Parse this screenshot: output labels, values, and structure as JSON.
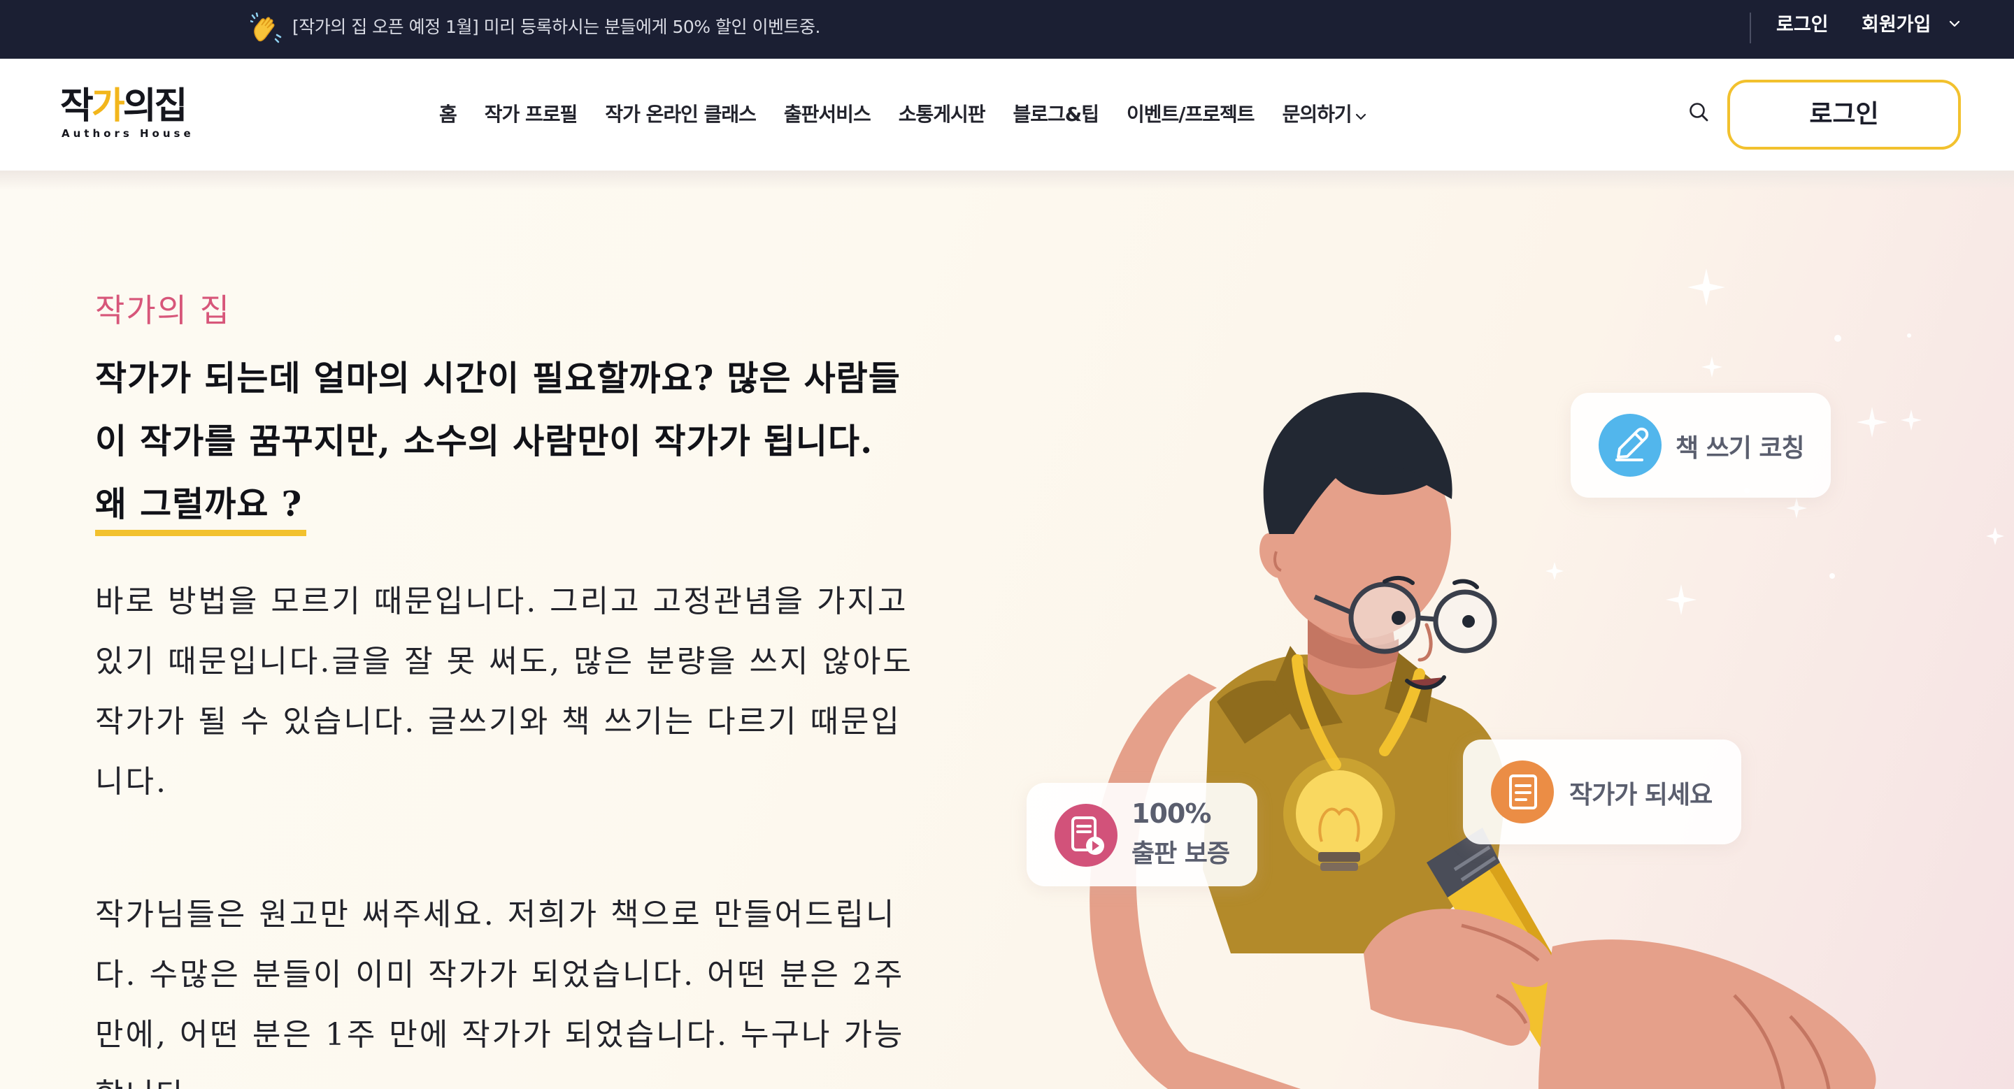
{
  "topbar": {
    "notice": "[작가의 집 오픈 예정 1월] 미리 등록하시는 분들에게 50% 할인 이벤트중.",
    "login": "로그인",
    "signup": "회원가입"
  },
  "header": {
    "logo_kr_a": "작",
    "logo_kr_b": "가",
    "logo_kr_c": "의집",
    "logo_en": "Authors House",
    "nav": [
      {
        "label": "홈"
      },
      {
        "label": "작가 프로필"
      },
      {
        "label": "작가 온라인 클래스"
      },
      {
        "label": "출판서비스"
      },
      {
        "label": "소통게시판"
      },
      {
        "label": "블로그&팁"
      },
      {
        "label": "이벤트/프로젝트"
      },
      {
        "label": "문의하기"
      }
    ],
    "login_button": "로그인"
  },
  "hero": {
    "eyebrow": "작가의 집",
    "headline_lines": [
      "작가가 되는데 얼마의 시간이 필요할까요? 많은 사람들",
      "이 작가를 꿈꾸지만, 소수의 사람만이 작가가 됩니다.",
      "왜 그럴까요 ?"
    ],
    "paragraph1_lines": [
      "바로 방법을 모르기 때문입니다. 그리고 고정관념을 가지고",
      "있기 때문입니다.글을 잘 못 써도, 많은 분량을 쓰지 않아도",
      "작가가 될 수 있습니다. 글쓰기와 책 쓰기는 다르기 때문입",
      "니다."
    ],
    "paragraph2_lines": [
      "작가님들은 원고만 써주세요. 저희가 책으로 만들어드립니",
      "다. 수많은 분들이 이미 작가가 되었습니다. 어떤 분은 2주",
      "만에, 어떤 분은 1주 만에 작가가 되었습니다. 누구나 가능",
      "합니다."
    ]
  },
  "cards": {
    "coach": "책 쓰기 코칭",
    "author": "작가가 되세요",
    "guarantee_line1": "100%",
    "guarantee_line2": "출판 보증"
  },
  "colors": {
    "topbar_bg": "#1b1f33",
    "accent_yellow": "#f2c12e",
    "eyebrow_pink": "#d7567a",
    "coach_blue": "#52b6ec",
    "author_orange": "#eb8d45",
    "guarantee_pink": "#d2527a"
  }
}
